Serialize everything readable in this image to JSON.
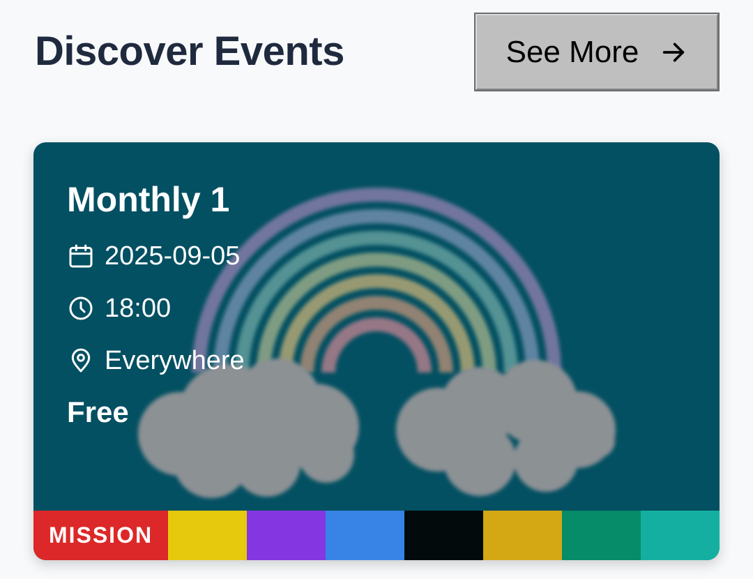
{
  "header": {
    "title": "Discover Events",
    "see_more_label": "See More",
    "see_more_icon": "arrow-right-icon"
  },
  "event": {
    "title": "Monthly 1",
    "date": "2025-09-05",
    "time": "18:00",
    "location": "Everywhere",
    "price": "Free",
    "icons": {
      "date": "calendar-icon",
      "time": "clock-icon",
      "location": "map-pin-icon"
    },
    "background_color": "#035062",
    "tags": [
      {
        "label": "MISSION",
        "color": "#dc2828"
      },
      {
        "label": "",
        "color": "#e6c80c"
      },
      {
        "label": "",
        "color": "#8437e0"
      },
      {
        "label": "",
        "color": "#3784e6"
      },
      {
        "label": "",
        "color": "#020a0c"
      },
      {
        "label": "",
        "color": "#d4a714"
      },
      {
        "label": "",
        "color": "#068c68"
      },
      {
        "label": "",
        "color": "#14afa0"
      }
    ]
  }
}
